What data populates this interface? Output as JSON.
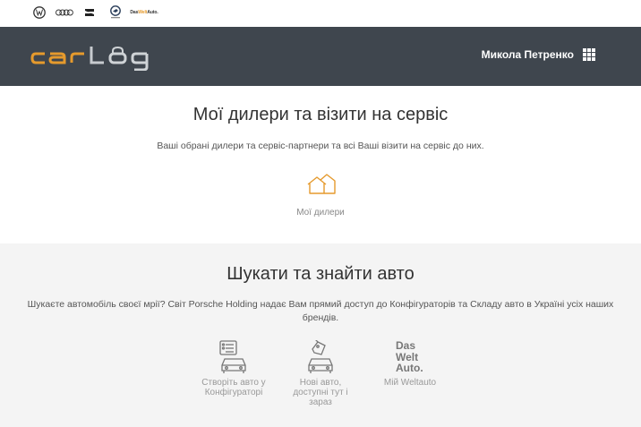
{
  "brands": [
    {
      "name": "vw-logo"
    },
    {
      "name": "audi-logo"
    },
    {
      "name": "seat-logo"
    },
    {
      "name": "skoda-logo"
    },
    {
      "name": "das-welt-auto-logo",
      "text_parts": [
        "Das",
        "Welt",
        "Auto."
      ]
    }
  ],
  "header": {
    "logo_text": "carlog",
    "user_name": "Микола Петренко",
    "apps_icon": "grid-apps-icon"
  },
  "dealers_section": {
    "title": "Мої дилери та візити на сервіс",
    "subtitle": "Ваші обрані дилери та сервіс-партнери та всі Ваші візити на сервіс до них.",
    "card": {
      "icon": "houses-icon",
      "label": "Мої дилери"
    }
  },
  "search_section": {
    "title": "Шукати та знайти авто",
    "subtitle": "Шукаєте автомобіль своєї мрії? Світ Porsche Holding надає Вам прямий доступ до Конфігураторів та Складу авто в Україні усіх наших брендів.",
    "tiles": [
      {
        "icon": "configurator-car-icon",
        "label_lines": [
          "Створіть авто у",
          "Конфігураторі"
        ]
      },
      {
        "icon": "new-car-tag-icon",
        "label_lines": [
          "Нові авто,",
          "доступні тут і",
          "зараз"
        ]
      },
      {
        "icon": "das-welt-auto-icon",
        "logo_lines": [
          "Das",
          "Welt",
          "Auto."
        ],
        "label_lines": [
          "Мій Weltauto"
        ]
      }
    ]
  },
  "colors": {
    "header_bg": "#3f464e",
    "accent": "#e59a2d",
    "section_gray": "#f4f4f4"
  }
}
